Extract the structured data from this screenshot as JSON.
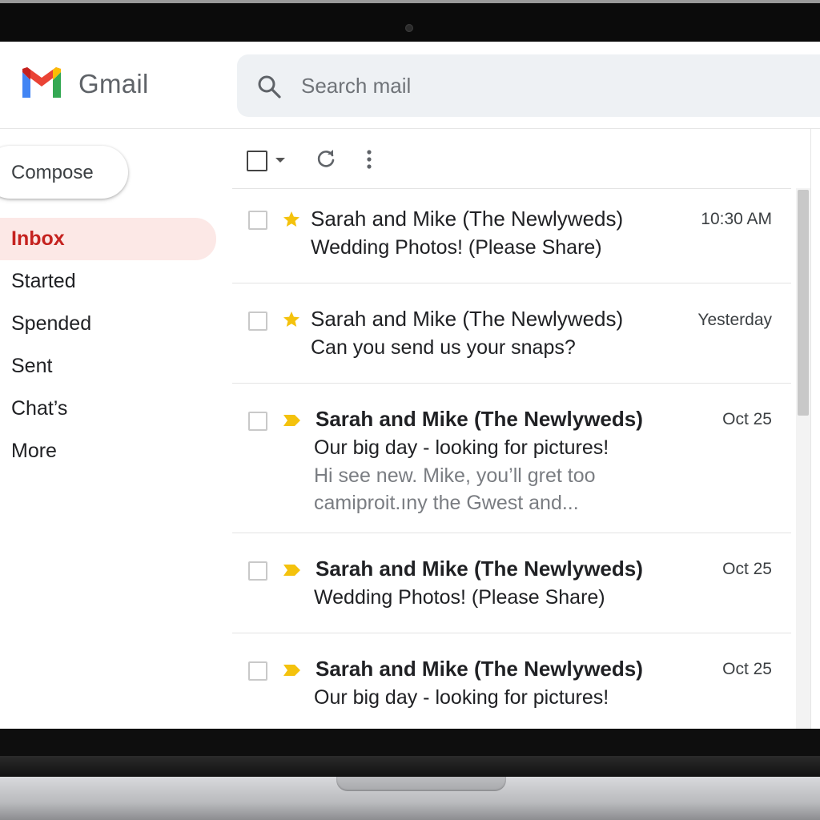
{
  "header": {
    "brand": "Gmail",
    "search_placeholder": "Search mail"
  },
  "sidebar": {
    "compose_label": "Compose",
    "items": [
      {
        "label": "Inbox",
        "active": true
      },
      {
        "label": "Started",
        "active": false
      },
      {
        "label": "Spended",
        "active": false
      },
      {
        "label": "Sent",
        "active": false
      },
      {
        "label": "Chat’s",
        "active": false
      },
      {
        "label": "More",
        "active": false
      }
    ]
  },
  "toolbar": {
    "icons": [
      "select-checkbox-icon",
      "chevron-down-icon",
      "refresh-icon",
      "more-vert-icon"
    ]
  },
  "emails": [
    {
      "sender": "Sarah and Mike (The Newlyweds)",
      "subject": "Wedding Photos! (Please Share)",
      "snippet": "",
      "time": "10:30 AM",
      "marker": "star",
      "unread": false
    },
    {
      "sender": "Sarah and Mike (The Newlyweds)",
      "subject": "Can you send us your snaps?",
      "snippet": "",
      "time": "Yesterday",
      "marker": "star",
      "unread": false
    },
    {
      "sender": "Sarah and Mike (The Newlyweds)",
      "subject": "Our big day - looking for pictures!",
      "snippet": "Hi see new. Mike, you’ll gret too",
      "snippet2": "camiproit.ıny the Gwest and...",
      "time": "Oct 25",
      "marker": "important",
      "unread": true
    },
    {
      "sender": "Sarah and Mike (The Newlyweds)",
      "subject": "Wedding Photos! (Please Share)",
      "snippet": "",
      "time": "Oct 25",
      "marker": "important",
      "unread": true
    },
    {
      "sender": "Sarah and Mike (The Newlyweds)",
      "subject": "Our big day - looking for pictures!",
      "snippet": "",
      "time": "Oct 25",
      "marker": "important",
      "unread": true
    }
  ],
  "colors": {
    "active_nav_bg": "#fce8e6",
    "active_nav_text": "#c5221f",
    "star": "#f4c20d",
    "search_bg": "#eef1f4"
  }
}
